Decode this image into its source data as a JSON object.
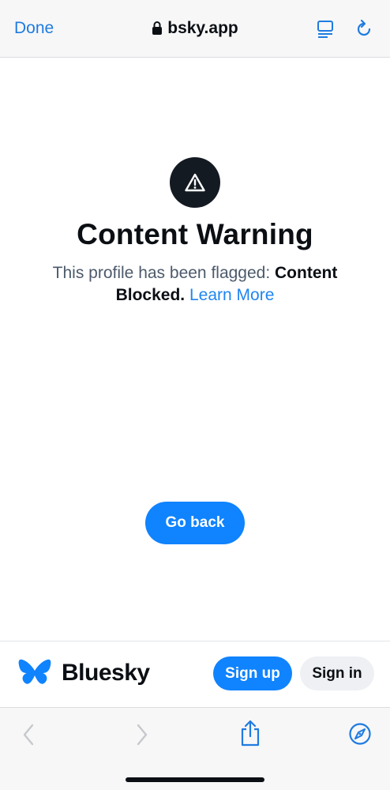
{
  "browser": {
    "done_label": "Done",
    "url": "bsky.app",
    "accent": "#1f7be0",
    "icons": [
      "lock-icon",
      "reader-icon",
      "reload-icon"
    ]
  },
  "warning": {
    "icon": "warning-triangle-icon",
    "title": "Content Warning",
    "desc_prefix": "This profile has been flagged: ",
    "desc_strong": "Content Blocked.",
    "learn_more": "Learn More"
  },
  "actions": {
    "go_back": "Go back"
  },
  "footer": {
    "brand": "Bluesky",
    "sign_up": "Sign up",
    "sign_in": "Sign in",
    "brand_color": "#1083fe"
  },
  "toolbar": {
    "icons": [
      "back-icon",
      "forward-icon",
      "share-icon",
      "safari-compass-icon"
    ]
  }
}
